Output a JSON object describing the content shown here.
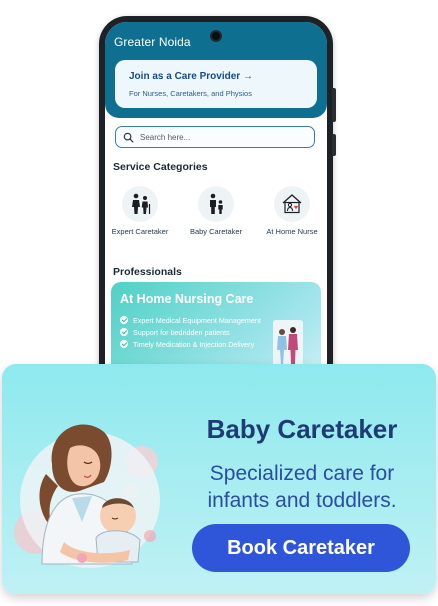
{
  "app": {
    "location": "Greater Noida"
  },
  "join_card": {
    "title": "Join as a Care Provider →",
    "subtitle": "For Nurses, Caretakers, and Physios"
  },
  "search": {
    "placeholder": "Search here..."
  },
  "service_categories": {
    "title": "Service Categories",
    "items": [
      {
        "label": "Expert Caretaker",
        "icon": "elderly-care-icon"
      },
      {
        "label": "Baby Caretaker",
        "icon": "family-icon"
      },
      {
        "label": "At Home Nurse",
        "icon": "home-nurse-icon"
      }
    ]
  },
  "professionals": {
    "title": "Professionals",
    "card": {
      "title": "At Home Nursing Care",
      "points": [
        "Expert Medical Equipment Management",
        "Support for bedridden patients",
        "Timely Medication & Injection Delivery"
      ]
    }
  },
  "banner": {
    "title": "Baby Caretaker",
    "subtitle_line1": "Specialized care for",
    "subtitle_line2": "infants and toddlers.",
    "button_label": "Book Caretaker"
  },
  "colors": {
    "primary": "#0e6f90",
    "card_gradient_start": "#4fd1c5",
    "banner_bg": "#8ee9ee",
    "button": "#2f56d8",
    "title_text": "#1e3b73"
  }
}
